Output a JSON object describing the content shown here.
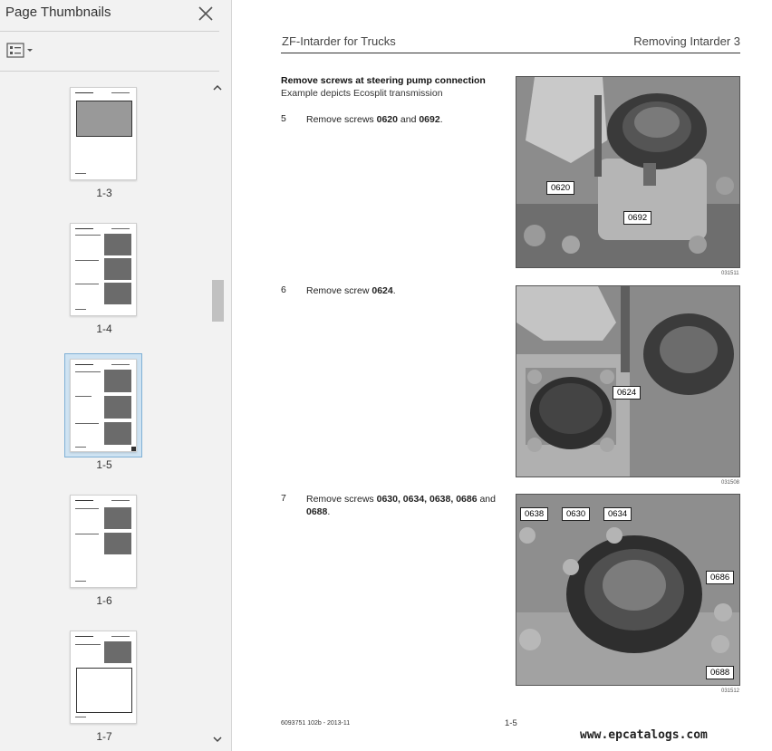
{
  "sidebar": {
    "title": "Page Thumbnails",
    "close_icon": "close-icon",
    "options_icon": "thumbnail-options-icon",
    "thumbnails": [
      {
        "label": "1-3"
      },
      {
        "label": "1-4"
      },
      {
        "label": "1-5"
      },
      {
        "label": "1-6"
      },
      {
        "label": "1-7"
      }
    ],
    "selected_label": "1-5"
  },
  "page": {
    "doc_title": "ZF-Intarder for Trucks",
    "section_title": "Removing Intarder 3",
    "intro_bold": "Remove screws at steering pump connection",
    "intro_sub": "Example depicts Ecosplit transmission",
    "steps": [
      {
        "num": "5",
        "prefix": "Remove screws ",
        "b1": "0620",
        "mid": " and ",
        "b2": "0692",
        "suffix": "."
      },
      {
        "num": "6",
        "prefix": "Remove screw ",
        "b1": "0624",
        "suffix": "."
      },
      {
        "num": "7",
        "prefix": "Remove screws ",
        "b1": "0630, 0634, 0638, 0686",
        "mid": " and",
        "b2": "0688",
        "suffix": "."
      }
    ],
    "photos": [
      {
        "id": "031511",
        "callouts": [
          "0620",
          "0692"
        ]
      },
      {
        "id": "031508",
        "callouts": [
          "0624"
        ]
      },
      {
        "id": "031512",
        "callouts": [
          "0638",
          "0630",
          "0634",
          "0686",
          "0688"
        ]
      }
    ],
    "footer_left": "6093751 102b - 2013-11",
    "page_number": "1-5"
  },
  "watermark": "www.epcatalogs.com"
}
